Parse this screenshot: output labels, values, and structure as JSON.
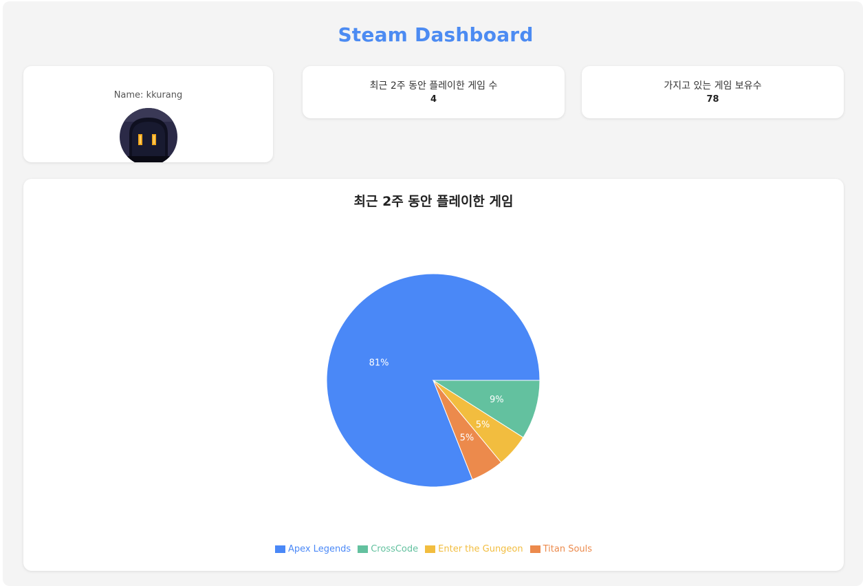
{
  "header": {
    "title": "Steam Dashboard"
  },
  "profile": {
    "name_label": "Name: kkurang",
    "avatar_icon": "hooded-figure-avatar"
  },
  "stats": [
    {
      "label": "최근 2주 동안 플레이한 게임 수",
      "value": "4"
    },
    {
      "label": "가지고 있는 게임 보유수",
      "value": "78"
    }
  ],
  "chart": {
    "title": "최근 2주 동안 플레이한 게임"
  },
  "chart_data": {
    "type": "pie",
    "title": "최근 2주 동안 플레이한 게임",
    "legend_position": "bottom",
    "slices": [
      {
        "name": "Apex Legends",
        "percent": 81,
        "label": "81%",
        "color": "#4a88f7"
      },
      {
        "name": "CrossCode",
        "percent": 9,
        "label": "9%",
        "color": "#63c19f"
      },
      {
        "name": "Enter the Gungeon",
        "percent": 5,
        "label": "5%",
        "color": "#f2bd3f"
      },
      {
        "name": "Titan Souls",
        "percent": 5,
        "label": "5%",
        "color": "#ec8a4c"
      }
    ]
  }
}
